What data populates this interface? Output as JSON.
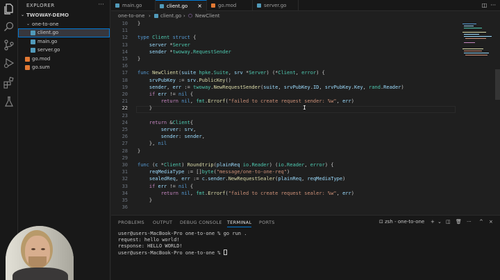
{
  "explorer": {
    "title": "EXPLORER",
    "project": "TWOWAY-DEMO",
    "items": [
      {
        "label": "one-to-one",
        "kind": "folder"
      },
      {
        "label": "client.go",
        "kind": "go"
      },
      {
        "label": "main.go",
        "kind": "go"
      },
      {
        "label": "server.go",
        "kind": "go"
      },
      {
        "label": "go.mod",
        "kind": "mod"
      },
      {
        "label": "go.sum",
        "kind": "mod"
      }
    ]
  },
  "tabs": [
    {
      "label": "main.go"
    },
    {
      "label": "client.go"
    },
    {
      "label": "go.mod"
    },
    {
      "label": "server.go"
    }
  ],
  "breadcrumb": [
    "one-to-one",
    "client.go",
    "NewClient"
  ],
  "editor": {
    "line_numbers": [
      "10",
      "11",
      "12",
      "13",
      "14",
      "15",
      "16",
      "17",
      "18",
      "19",
      "20",
      "21",
      "22",
      "23",
      "24",
      "25",
      "26",
      "27",
      "28",
      "29",
      "30",
      "31",
      "32",
      "33",
      "34",
      "35",
      "36"
    ]
  },
  "panel": {
    "tabs": [
      "PROBLEMS",
      "OUTPUT",
      "DEBUG CONSOLE",
      "TERMINAL",
      "PORTS"
    ],
    "shell_label": "zsh - one-to-one",
    "terminal_lines": [
      "user@users-MacBook-Pro one-to-one % go run .",
      "request: hello world!",
      "response: HELLO WORLD!",
      "user@users-MacBook-Pro one-to-one % "
    ]
  },
  "colors": {
    "accent": "#0078d4",
    "keyword": "#569cd6",
    "type": "#4ec9b0",
    "function": "#dcdcaa",
    "string": "#ce9178"
  }
}
